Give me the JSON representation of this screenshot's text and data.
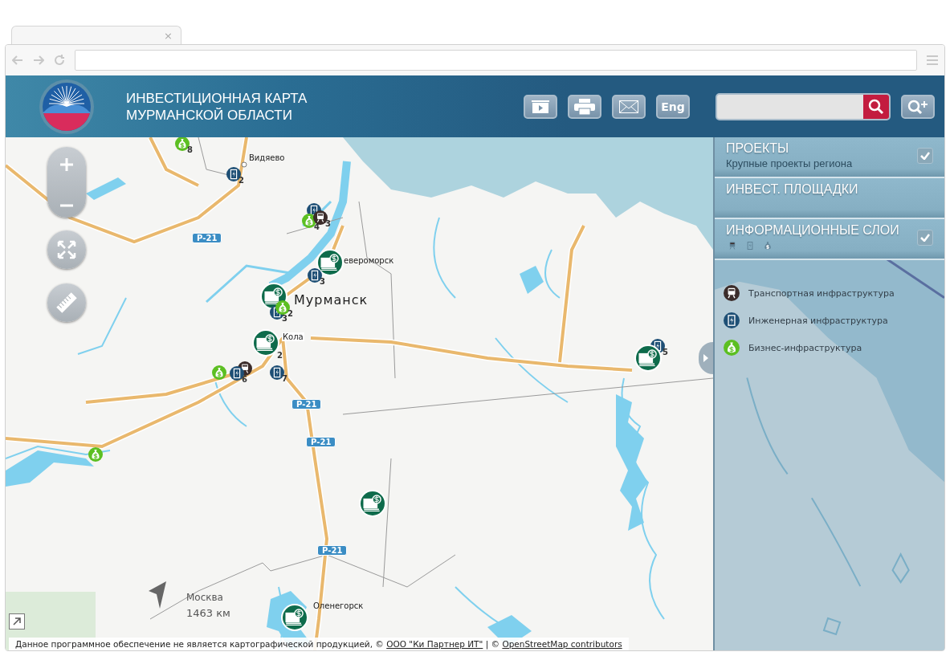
{
  "browser": {
    "tab_close": "×"
  },
  "header": {
    "title_lines": [
      "ИНВЕСТИЦИОННАЯ КАРТА",
      "МУРМАНСКОЙ ОБЛАСТИ"
    ],
    "tools": [
      {
        "kind": "slideshow"
      },
      {
        "kind": "print"
      },
      {
        "kind": "mail"
      },
      {
        "kind": "language",
        "label": "Eng"
      }
    ]
  },
  "map": {
    "places": [
      {
        "kind": "town",
        "name": "Видяево"
      },
      {
        "kind": "town",
        "name": "евероморск"
      },
      {
        "kind": "city",
        "name": "Мурманск"
      },
      {
        "kind": "boxed",
        "name": "Кола"
      },
      {
        "kind": "town",
        "name": "Оленегорск"
      }
    ],
    "road_labels": [
      "Р-21",
      "Р-21",
      "Р-21",
      "Р-21"
    ],
    "markers": [
      {
        "kind": "business",
        "count": "8"
      },
      {
        "kind": "engineering",
        "count": "2"
      },
      {
        "kind": "engineering"
      },
      {
        "kind": "business",
        "count": "4"
      },
      {
        "kind": "transport",
        "count": "3"
      },
      {
        "kind": "project"
      },
      {
        "kind": "engineering",
        "count": "3"
      },
      {
        "kind": "project"
      },
      {
        "kind": "engineering",
        "count": "3"
      },
      {
        "kind": "business",
        "count": "2"
      },
      {
        "kind": "project",
        "count": "2"
      },
      {
        "kind": "business"
      },
      {
        "kind": "transport"
      },
      {
        "kind": "engineering",
        "count": "6"
      },
      {
        "kind": "engineering",
        "count": "7"
      },
      {
        "kind": "engineering",
        "count": "5"
      },
      {
        "kind": "project"
      },
      {
        "kind": "business"
      },
      {
        "kind": "project"
      },
      {
        "kind": "project"
      }
    ],
    "direction": {
      "city": "Москва",
      "distance": "1463 км"
    },
    "attribution": [
      {
        "kind": "text",
        "text": "Данное программное обеспечение не является картографической продукцией, © "
      },
      {
        "kind": "link",
        "text": "ООО \"Ки Партнер ИТ\""
      },
      {
        "kind": "text",
        "text": " | © "
      },
      {
        "kind": "link",
        "text": "OpenStreetMap contributors"
      }
    ]
  },
  "sidebar": {
    "sections": [
      {
        "title": "ПРОЕКТЫ",
        "subtitle": "Крупные проекты региона",
        "checked": true
      },
      {
        "title": "ИНВЕСТ. ПЛОЩАДКИ"
      },
      {
        "title": "ИНФОРМАЦИОННЫЕ СЛОИ",
        "checked": true,
        "layer_icons": [
          {
            "kind": "transport"
          },
          {
            "kind": "engineering"
          },
          {
            "kind": "business"
          }
        ]
      }
    ],
    "legend": [
      {
        "kind": "transport",
        "label": "Транспортная инфраструктура"
      },
      {
        "kind": "engineering",
        "label": "Инженерная инфраструктура"
      },
      {
        "kind": "business",
        "label": "Бизнес-инфраструктура"
      }
    ]
  }
}
